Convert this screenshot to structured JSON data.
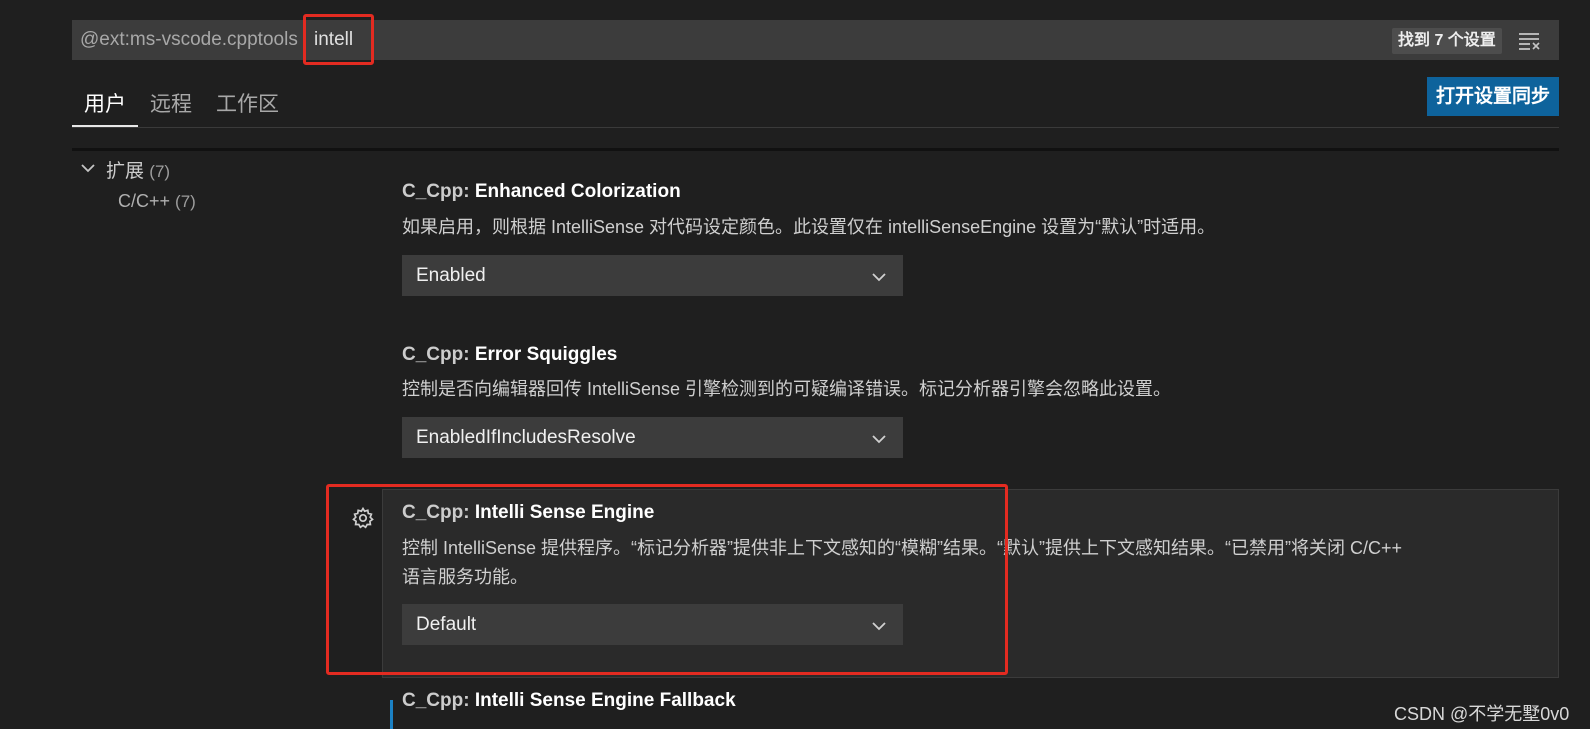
{
  "search": {
    "prefix": "@ext:ms-vscode.cpptools",
    "query": "intell",
    "result_count": "找到 7 个设置"
  },
  "tabs": [
    {
      "label": "用户",
      "active": true
    },
    {
      "label": "远程",
      "active": false
    },
    {
      "label": "工作区",
      "active": false
    }
  ],
  "sync_button_label": "打开设置同步",
  "toc": {
    "group_label": "扩展",
    "group_count": "(7)",
    "sub_label": "C/C++",
    "sub_count": "(7)"
  },
  "settings": [
    {
      "category": "C_Cpp: ",
      "name": "Enhanced Colorization",
      "description": "如果启用，则根据 IntelliSense 对代码设定颜色。此设置仅在 intelliSenseEngine 设置为“默认”时适用。",
      "value": "Enabled"
    },
    {
      "category": "C_Cpp: ",
      "name": "Error Squiggles",
      "description": "控制是否向编辑器回传 IntelliSense 引擎检测到的可疑编译错误。标记分析器引擎会忽略此设置。",
      "value": "EnabledIfIncludesResolve"
    },
    {
      "category": "C_Cpp: ",
      "name": "Intelli Sense Engine",
      "description_line1": "控制 IntelliSense 提供程序。“标记分析器”提供非上下文感知的“模糊”结果。“默认”提供上下文感知结果。“已禁用”将关闭 C/C++",
      "description_line2": "语言服务功能。",
      "value": "Default"
    },
    {
      "category": "C_Cpp: ",
      "name": "Intelli Sense Engine Fallback"
    }
  ],
  "watermark": "CSDN @不学无墅0v0",
  "colors": {
    "background": "#1f1f1f",
    "input_background": "#3c3c3c",
    "button_blue": "#0e639c",
    "highlight_red": "#e32b21",
    "modified_blue": "#1b81c4"
  },
  "icons": [
    "filter-clear-icon",
    "chevron-down-icon",
    "gear-icon"
  ]
}
